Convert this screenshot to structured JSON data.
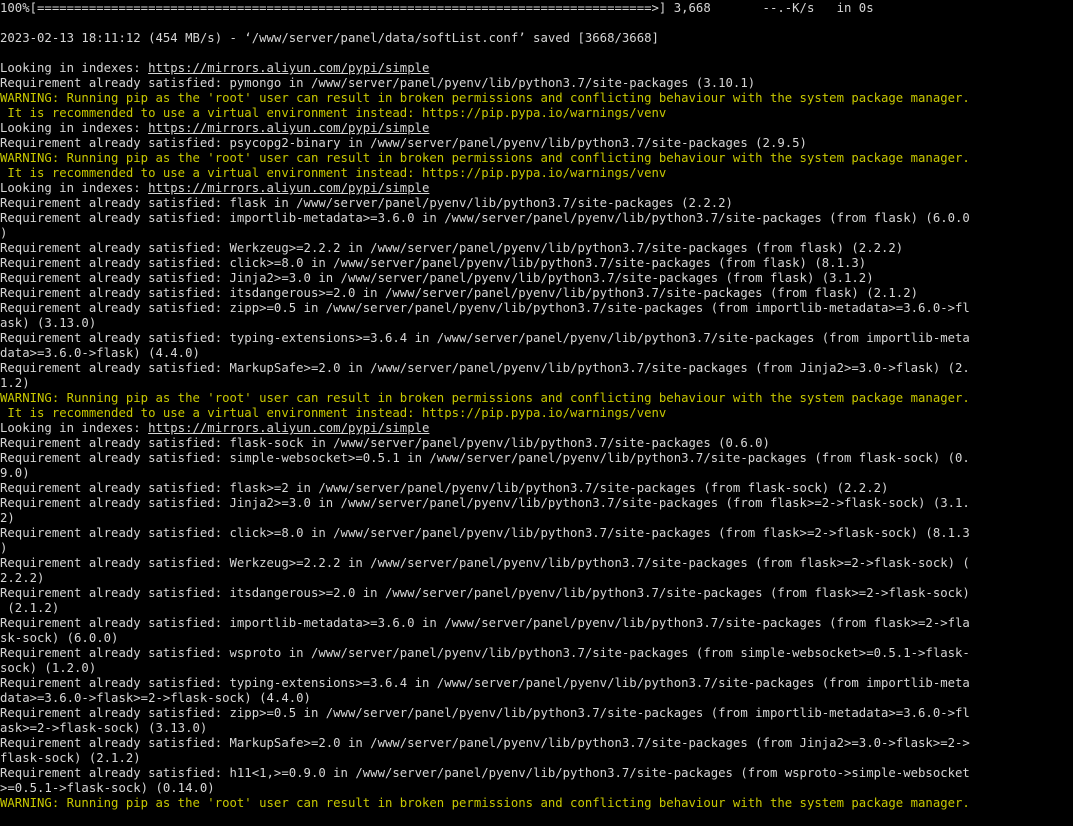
{
  "colors": {
    "background": "#000000",
    "normal": "#d6d6d6",
    "warning": "#c8c800",
    "link": "#d6d6d6"
  },
  "lines": [
    {
      "type": "normal",
      "text": "100%[===================================================================================>] 3,668       --.-K/s   in 0s"
    },
    {
      "type": "blank",
      "text": ""
    },
    {
      "type": "normal",
      "text": "2023-02-13 18:11:12 (454 MB/s) - ‘/www/server/panel/data/softList.conf’ saved [3668/3668]"
    },
    {
      "type": "blank",
      "text": ""
    },
    {
      "type": "link",
      "prefix": "Looking in indexes: ",
      "link": "https://mirrors.aliyun.com/pypi/simple"
    },
    {
      "type": "normal",
      "text": "Requirement already satisfied: pymongo in /www/server/panel/pyenv/lib/python3.7/site-packages (3.10.1)"
    },
    {
      "type": "warning",
      "text": "WARNING: Running pip as the 'root' user can result in broken permissions and conflicting behaviour with the system package manager."
    },
    {
      "type": "warning",
      "text": " It is recommended to use a virtual environment instead: https://pip.pypa.io/warnings/venv"
    },
    {
      "type": "link",
      "prefix": "Looking in indexes: ",
      "link": "https://mirrors.aliyun.com/pypi/simple"
    },
    {
      "type": "normal",
      "text": "Requirement already satisfied: psycopg2-binary in /www/server/panel/pyenv/lib/python3.7/site-packages (2.9.5)"
    },
    {
      "type": "warning",
      "text": "WARNING: Running pip as the 'root' user can result in broken permissions and conflicting behaviour with the system package manager."
    },
    {
      "type": "warning",
      "text": " It is recommended to use a virtual environment instead: https://pip.pypa.io/warnings/venv"
    },
    {
      "type": "link",
      "prefix": "Looking in indexes: ",
      "link": "https://mirrors.aliyun.com/pypi/simple"
    },
    {
      "type": "normal",
      "text": "Requirement already satisfied: flask in /www/server/panel/pyenv/lib/python3.7/site-packages (2.2.2)"
    },
    {
      "type": "normal",
      "text": "Requirement already satisfied: importlib-metadata>=3.6.0 in /www/server/panel/pyenv/lib/python3.7/site-packages (from flask) (6.0.0"
    },
    {
      "type": "normal",
      "text": ")"
    },
    {
      "type": "normal",
      "text": "Requirement already satisfied: Werkzeug>=2.2.2 in /www/server/panel/pyenv/lib/python3.7/site-packages (from flask) (2.2.2)"
    },
    {
      "type": "normal",
      "text": "Requirement already satisfied: click>=8.0 in /www/server/panel/pyenv/lib/python3.7/site-packages (from flask) (8.1.3)"
    },
    {
      "type": "normal",
      "text": "Requirement already satisfied: Jinja2>=3.0 in /www/server/panel/pyenv/lib/python3.7/site-packages (from flask) (3.1.2)"
    },
    {
      "type": "normal",
      "text": "Requirement already satisfied: itsdangerous>=2.0 in /www/server/panel/pyenv/lib/python3.7/site-packages (from flask) (2.1.2)"
    },
    {
      "type": "normal",
      "text": "Requirement already satisfied: zipp>=0.5 in /www/server/panel/pyenv/lib/python3.7/site-packages (from importlib-metadata>=3.6.0->fl"
    },
    {
      "type": "normal",
      "text": "ask) (3.13.0)"
    },
    {
      "type": "normal",
      "text": "Requirement already satisfied: typing-extensions>=3.6.4 in /www/server/panel/pyenv/lib/python3.7/site-packages (from importlib-meta"
    },
    {
      "type": "normal",
      "text": "data>=3.6.0->flask) (4.4.0)"
    },
    {
      "type": "normal",
      "text": "Requirement already satisfied: MarkupSafe>=2.0 in /www/server/panel/pyenv/lib/python3.7/site-packages (from Jinja2>=3.0->flask) (2."
    },
    {
      "type": "normal",
      "text": "1.2)"
    },
    {
      "type": "warning",
      "text": "WARNING: Running pip as the 'root' user can result in broken permissions and conflicting behaviour with the system package manager."
    },
    {
      "type": "warning",
      "text": " It is recommended to use a virtual environment instead: https://pip.pypa.io/warnings/venv"
    },
    {
      "type": "link",
      "prefix": "Looking in indexes: ",
      "link": "https://mirrors.aliyun.com/pypi/simple"
    },
    {
      "type": "normal",
      "text": "Requirement already satisfied: flask-sock in /www/server/panel/pyenv/lib/python3.7/site-packages (0.6.0)"
    },
    {
      "type": "normal",
      "text": "Requirement already satisfied: simple-websocket>=0.5.1 in /www/server/panel/pyenv/lib/python3.7/site-packages (from flask-sock) (0."
    },
    {
      "type": "normal",
      "text": "9.0)"
    },
    {
      "type": "normal",
      "text": "Requirement already satisfied: flask>=2 in /www/server/panel/pyenv/lib/python3.7/site-packages (from flask-sock) (2.2.2)"
    },
    {
      "type": "normal",
      "text": "Requirement already satisfied: Jinja2>=3.0 in /www/server/panel/pyenv/lib/python3.7/site-packages (from flask>=2->flask-sock) (3.1."
    },
    {
      "type": "normal",
      "text": "2)"
    },
    {
      "type": "normal",
      "text": "Requirement already satisfied: click>=8.0 in /www/server/panel/pyenv/lib/python3.7/site-packages (from flask>=2->flask-sock) (8.1.3"
    },
    {
      "type": "normal",
      "text": ")"
    },
    {
      "type": "normal",
      "text": "Requirement already satisfied: Werkzeug>=2.2.2 in /www/server/panel/pyenv/lib/python3.7/site-packages (from flask>=2->flask-sock) ("
    },
    {
      "type": "normal",
      "text": "2.2.2)"
    },
    {
      "type": "normal",
      "text": "Requirement already satisfied: itsdangerous>=2.0 in /www/server/panel/pyenv/lib/python3.7/site-packages (from flask>=2->flask-sock)"
    },
    {
      "type": "normal",
      "text": " (2.1.2)"
    },
    {
      "type": "normal",
      "text": "Requirement already satisfied: importlib-metadata>=3.6.0 in /www/server/panel/pyenv/lib/python3.7/site-packages (from flask>=2->fla"
    },
    {
      "type": "normal",
      "text": "sk-sock) (6.0.0)"
    },
    {
      "type": "normal",
      "text": "Requirement already satisfied: wsproto in /www/server/panel/pyenv/lib/python3.7/site-packages (from simple-websocket>=0.5.1->flask-"
    },
    {
      "type": "normal",
      "text": "sock) (1.2.0)"
    },
    {
      "type": "normal",
      "text": "Requirement already satisfied: typing-extensions>=3.6.4 in /www/server/panel/pyenv/lib/python3.7/site-packages (from importlib-meta"
    },
    {
      "type": "normal",
      "text": "data>=3.6.0->flask>=2->flask-sock) (4.4.0)"
    },
    {
      "type": "normal",
      "text": "Requirement already satisfied: zipp>=0.5 in /www/server/panel/pyenv/lib/python3.7/site-packages (from importlib-metadata>=3.6.0->fl"
    },
    {
      "type": "normal",
      "text": "ask>=2->flask-sock) (3.13.0)"
    },
    {
      "type": "normal",
      "text": "Requirement already satisfied: MarkupSafe>=2.0 in /www/server/panel/pyenv/lib/python3.7/site-packages (from Jinja2>=3.0->flask>=2->"
    },
    {
      "type": "normal",
      "text": "flask-sock) (2.1.2)"
    },
    {
      "type": "normal",
      "text": "Requirement already satisfied: h11<1,>=0.9.0 in /www/server/panel/pyenv/lib/python3.7/site-packages (from wsproto->simple-websocket"
    },
    {
      "type": "normal",
      "text": ">=0.5.1->flask-sock) (0.14.0)"
    },
    {
      "type": "warning",
      "text": "WARNING: Running pip as the 'root' user can result in broken permissions and conflicting behaviour with the system package manager."
    }
  ]
}
